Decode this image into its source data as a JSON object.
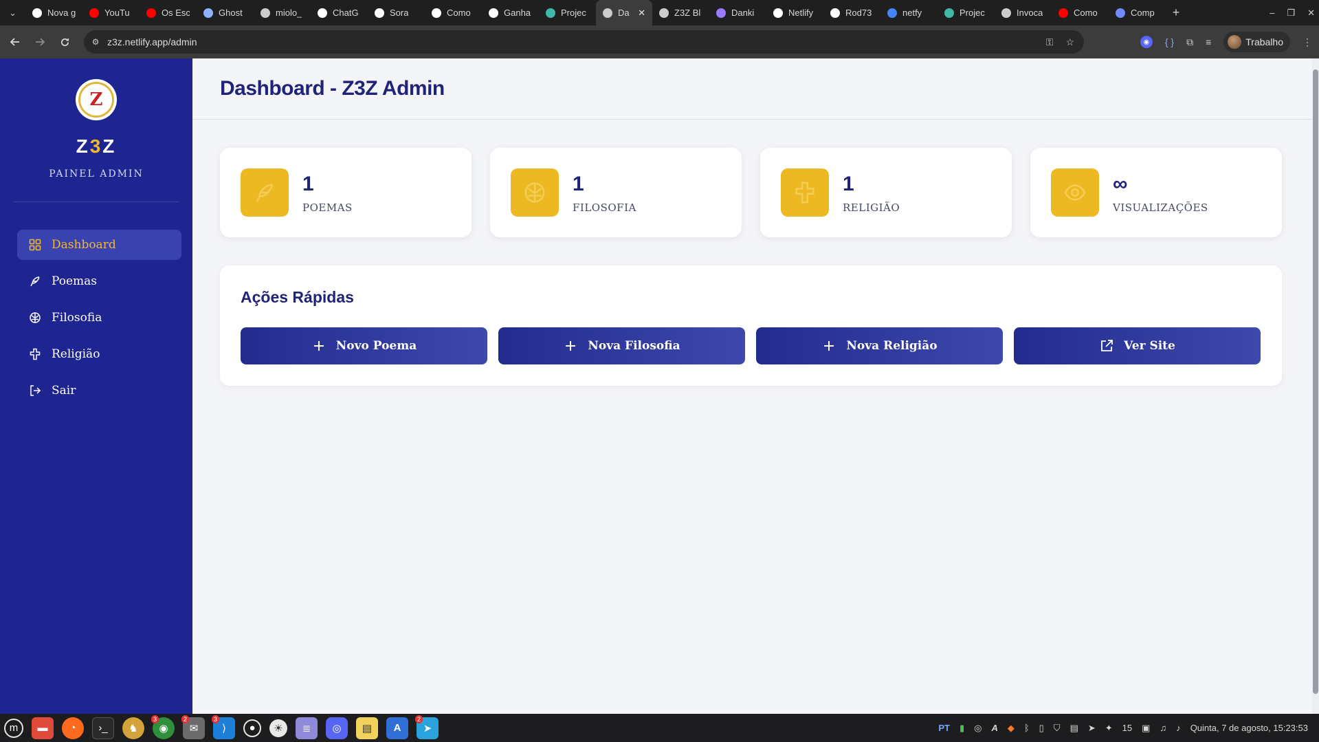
{
  "browser": {
    "tabs": [
      {
        "title": "Nova g",
        "icon": "chatgpt-icon",
        "color": "#ffffff"
      },
      {
        "title": "YouTu",
        "icon": "youtube-icon",
        "color": "#ff0000"
      },
      {
        "title": "Os Esc",
        "icon": "youtube-icon",
        "color": "#ff0000"
      },
      {
        "title": "Ghost",
        "icon": "ghost-icon",
        "color": "#8fb3ff"
      },
      {
        "title": "miolo_",
        "icon": "globe-icon",
        "color": "#cccccc"
      },
      {
        "title": "ChatG",
        "icon": "chatgpt-icon",
        "color": "#ffffff"
      },
      {
        "title": "Sora",
        "icon": "sora-icon",
        "color": "#ffffff"
      },
      {
        "title": "Como",
        "icon": "chatgpt-icon",
        "color": "#ffffff"
      },
      {
        "title": "Ganha",
        "icon": "chatgpt-icon",
        "color": "#ffffff"
      },
      {
        "title": "Projec",
        "icon": "diamond-icon",
        "color": "#3fb8a8"
      },
      {
        "title": "Da",
        "icon": "globe-icon",
        "color": "#cccccc",
        "active": true
      },
      {
        "title": "Z3Z Bl",
        "icon": "globe-icon",
        "color": "#cccccc"
      },
      {
        "title": "Danki",
        "icon": "code-icon",
        "color": "#9a7bff"
      },
      {
        "title": "Netlify",
        "icon": "chatgpt-icon",
        "color": "#ffffff"
      },
      {
        "title": "Rod73",
        "icon": "github-icon",
        "color": "#ffffff"
      },
      {
        "title": "netfy",
        "icon": "google-icon",
        "color": "#4285f4"
      },
      {
        "title": "Projec",
        "icon": "diamond-icon",
        "color": "#3fb8a8"
      },
      {
        "title": "Invoca",
        "icon": "globe-icon",
        "color": "#cccccc"
      },
      {
        "title": "Como",
        "icon": "youtube-icon",
        "color": "#ff0000"
      },
      {
        "title": "Comp",
        "icon": "docs-icon",
        "color": "#6c8cff"
      }
    ],
    "url": "z3z.netlify.app/admin",
    "profile_name": "Trabalho"
  },
  "sidebar": {
    "brand_left": "Z",
    "brand_mid": "3",
    "brand_right": "Z",
    "logo_letter": "Z",
    "subtitle": "PAINEL ADMIN",
    "items": [
      {
        "label": "Dashboard",
        "icon": "grid-icon",
        "active": true
      },
      {
        "label": "Poemas",
        "icon": "feather-icon"
      },
      {
        "label": "Filosofia",
        "icon": "brain-icon"
      },
      {
        "label": "Religião",
        "icon": "cross-icon"
      },
      {
        "label": "Sair",
        "icon": "logout-icon"
      }
    ]
  },
  "header": {
    "title": "Dashboard - Z3Z Admin"
  },
  "stats": [
    {
      "value": "1",
      "label": "POEMAS",
      "icon": "feather-icon"
    },
    {
      "value": "1",
      "label": "FILOSOFIA",
      "icon": "brain-icon"
    },
    {
      "value": "1",
      "label": "RELIGIÃO",
      "icon": "cross-icon"
    },
    {
      "value": "∞",
      "label": "VISUALIZAÇÕES",
      "icon": "eye-icon"
    }
  ],
  "quick_actions": {
    "title": "Ações Rápidas",
    "buttons": [
      {
        "label": "Novo Poema",
        "icon": "plus-icon"
      },
      {
        "label": "Nova Filosofia",
        "icon": "plus-icon"
      },
      {
        "label": "Nova Religião",
        "icon": "plus-icon"
      },
      {
        "label": "Ver Site",
        "icon": "external-link-icon"
      }
    ]
  },
  "taskbar": {
    "badges": {
      "chrome": "3",
      "mail": "2",
      "vscode": "3",
      "telegram": "2"
    },
    "lang": "PT",
    "tray_count": "15",
    "datetime": "Quinta, 7 de agosto, 15:23:53"
  },
  "colors": {
    "sidebar_bg": "#1f2590",
    "accent_gold": "#edb923",
    "title_navy": "#1f2478",
    "button_navy": "#2b3494"
  }
}
